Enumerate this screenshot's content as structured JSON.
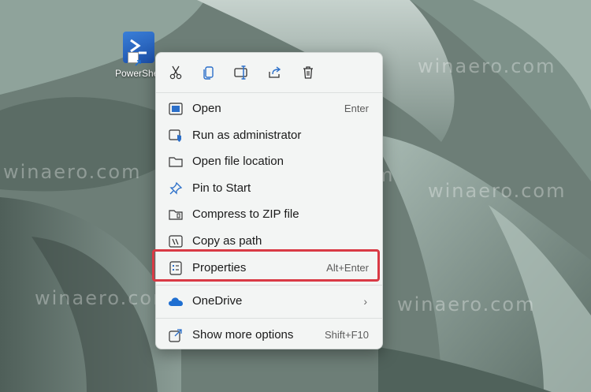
{
  "desktop": {
    "icon_label": "PowerShell",
    "watermark": "winaero.com"
  },
  "toolbar": [
    {
      "name": "cut-icon",
      "title": "Cut"
    },
    {
      "name": "copy-icon",
      "title": "Copy"
    },
    {
      "name": "rename-icon",
      "title": "Rename"
    },
    {
      "name": "share-icon",
      "title": "Share"
    },
    {
      "name": "delete-icon",
      "title": "Delete"
    }
  ],
  "menu": {
    "open": {
      "label": "Open",
      "shortcut": "Enter"
    },
    "run_admin": {
      "label": "Run as administrator"
    },
    "open_location": {
      "label": "Open file location"
    },
    "pin_start": {
      "label": "Pin to Start"
    },
    "compress_zip": {
      "label": "Compress to ZIP file"
    },
    "copy_path": {
      "label": "Copy as path"
    },
    "properties": {
      "label": "Properties",
      "shortcut": "Alt+Enter"
    },
    "onedrive": {
      "label": "OneDrive"
    },
    "more_options": {
      "label": "Show more options",
      "shortcut": "Shift+F10"
    }
  },
  "colors": {
    "highlight_border": "#d93a45",
    "accent": "#1f6fd1"
  }
}
